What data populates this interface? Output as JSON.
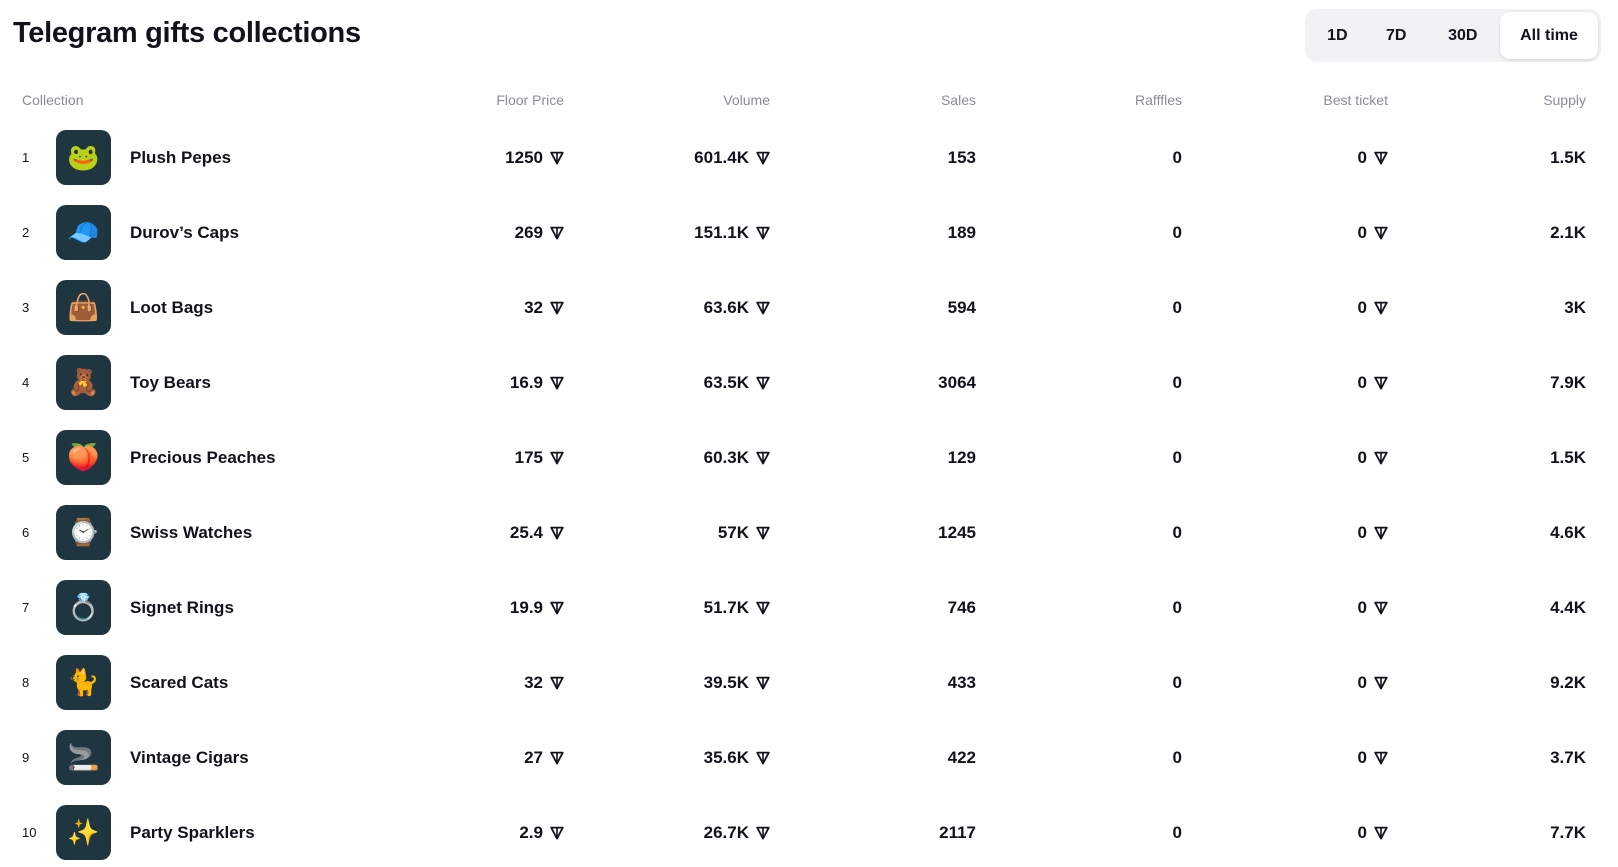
{
  "header": {
    "title": "Telegram gifts collections"
  },
  "period_tabs": [
    {
      "label": "1D",
      "active": false
    },
    {
      "label": "7D",
      "active": false
    },
    {
      "label": "30D",
      "active": false
    },
    {
      "label": "All time",
      "active": true
    }
  ],
  "table": {
    "columns": {
      "collection": "Collection",
      "floor_price": "Floor Price",
      "volume": "Volume",
      "sales": "Sales",
      "raffles": "Rafffles",
      "best_ticket": "Best ticket",
      "supply": "Supply"
    },
    "currency_icon": "ton-icon",
    "rows": [
      {
        "rank": "1",
        "name": "Plush Pepes",
        "icon": "plush-pepe-icon",
        "floor": "1250",
        "volume": "601.4K",
        "sales": "153",
        "raffles": "0",
        "best_ticket": "0",
        "supply": "1.5K"
      },
      {
        "rank": "2",
        "name": "Durov’s Caps",
        "icon": "durov-cap-icon",
        "floor": "269",
        "volume": "151.1K",
        "sales": "189",
        "raffles": "0",
        "best_ticket": "0",
        "supply": "2.1K"
      },
      {
        "rank": "3",
        "name": "Loot Bags",
        "icon": "loot-bag-icon",
        "floor": "32",
        "volume": "63.6K",
        "sales": "594",
        "raffles": "0",
        "best_ticket": "0",
        "supply": "3K"
      },
      {
        "rank": "4",
        "name": "Toy Bears",
        "icon": "toy-bear-icon",
        "floor": "16.9",
        "volume": "63.5K",
        "sales": "3064",
        "raffles": "0",
        "best_ticket": "0",
        "supply": "7.9K"
      },
      {
        "rank": "5",
        "name": "Precious Peaches",
        "icon": "precious-peach-icon",
        "floor": "175",
        "volume": "60.3K",
        "sales": "129",
        "raffles": "0",
        "best_ticket": "0",
        "supply": "1.5K"
      },
      {
        "rank": "6",
        "name": "Swiss Watches",
        "icon": "swiss-watch-icon",
        "floor": "25.4",
        "volume": "57K",
        "sales": "1245",
        "raffles": "0",
        "best_ticket": "0",
        "supply": "4.6K"
      },
      {
        "rank": "7",
        "name": "Signet Rings",
        "icon": "signet-ring-icon",
        "floor": "19.9",
        "volume": "51.7K",
        "sales": "746",
        "raffles": "0",
        "best_ticket": "0",
        "supply": "4.4K"
      },
      {
        "rank": "8",
        "name": "Scared Cats",
        "icon": "scared-cat-icon",
        "floor": "32",
        "volume": "39.5K",
        "sales": "433",
        "raffles": "0",
        "best_ticket": "0",
        "supply": "9.2K"
      },
      {
        "rank": "9",
        "name": "Vintage Cigars",
        "icon": "vintage-cigar-icon",
        "floor": "27",
        "volume": "35.6K",
        "sales": "422",
        "raffles": "0",
        "best_ticket": "0",
        "supply": "3.7K"
      },
      {
        "rank": "10",
        "name": "Party Sparklers",
        "icon": "party-sparkler-icon",
        "floor": "2.9",
        "volume": "26.7K",
        "sales": "2117",
        "raffles": "0",
        "best_ticket": "0",
        "supply": "7.7K"
      }
    ]
  },
  "colors": {
    "text": "#12131a",
    "muted": "#8a8d96",
    "switch_bg": "#f1f2f4",
    "thumb_bg": "#1f3540"
  }
}
